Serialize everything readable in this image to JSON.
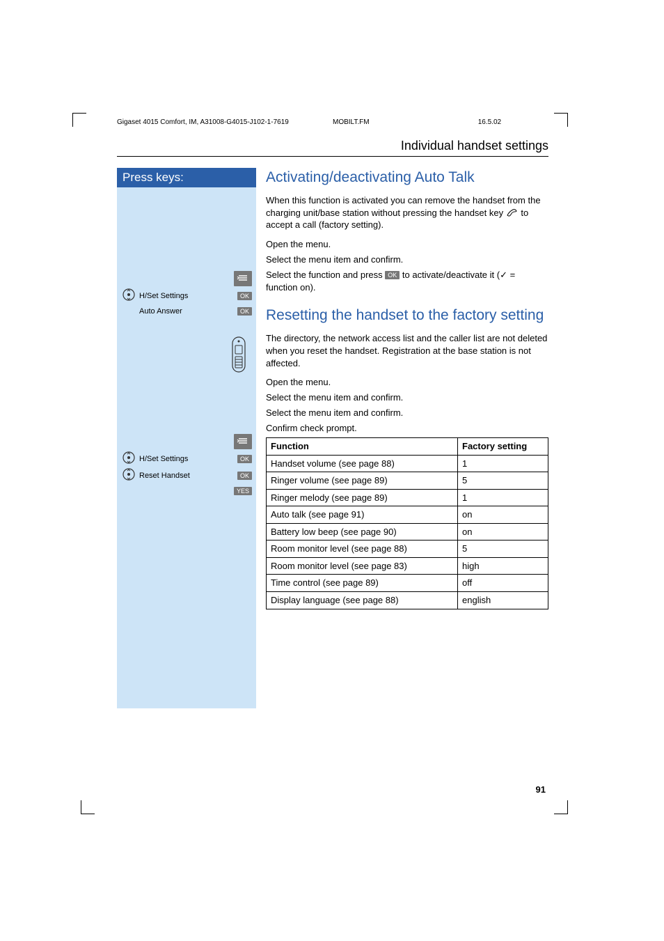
{
  "meta": {
    "doc_id": "Gigaset 4015 Comfort, IM, A31008-G4015-J102-1-7619",
    "file": "MOBILT.FM",
    "date": "16.5.02"
  },
  "section_title": "Individual handset settings",
  "press_keys_label": "Press keys:",
  "auto_talk": {
    "heading": "Activating/deactivating Auto Talk",
    "intro_pre": "When this function is activated you can remove the handset from the charging unit/base station without pressing the handset key ",
    "intro_post": " to accept a call (factory setting).",
    "step_open": "Open the menu.",
    "step_select1": "Select the menu item and confirm.",
    "step_activate_pre": "Select the function and press ",
    "step_activate_post": " to activate/deactivate it (✓ = function on).",
    "left": {
      "item1": "H/Set Settings",
      "item2": "Auto Answer",
      "ok": "OK"
    }
  },
  "reset": {
    "heading": "Resetting the handset to the factory setting",
    "intro": "The directory, the network access list and the caller list are not deleted when you reset the handset. Registration at the base station is not affected.",
    "step_open": "Open the menu.",
    "step_select1": "Select the menu item and confirm.",
    "step_select2": "Select the menu item and confirm.",
    "step_confirm": "Confirm check prompt.",
    "left": {
      "item1": "H/Set Settings",
      "item2": "Reset Handset",
      "ok": "OK",
      "yes": "YES"
    }
  },
  "table": {
    "h1": "Function",
    "h2": "Factory setting",
    "rows": [
      {
        "f": "Handset volume (see page 88)",
        "s": "1"
      },
      {
        "f": "Ringer volume (see page 89)",
        "s": "5"
      },
      {
        "f": "Ringer melody  (see page 89)",
        "s": "1"
      },
      {
        "f": "Auto talk (see page 91)",
        "s": "on"
      },
      {
        "f": "Battery low beep (see page 90)",
        "s": "on"
      },
      {
        "f": "Room monitor level (see page 88)",
        "s": "5"
      },
      {
        "f": "Room monitor level (see page 83)",
        "s": "high"
      },
      {
        "f": "Time control (see page 89)",
        "s": "off"
      },
      {
        "f": "Display language (see page 88)",
        "s": "english"
      }
    ]
  },
  "page_number": "91",
  "icons": {
    "ok_inline": "OK"
  }
}
